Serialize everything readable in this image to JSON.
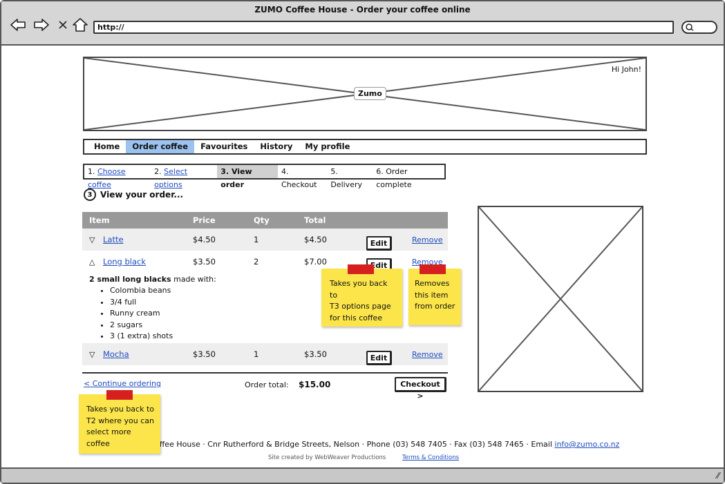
{
  "browser": {
    "title": "ZUMO Coffee House - Order your coffee online",
    "url": "http://"
  },
  "banner": {
    "logo": "Zumo",
    "greeting": "Hi John!"
  },
  "mainnav": [
    {
      "label": "Home",
      "active": false
    },
    {
      "label": "Order coffee",
      "active": true
    },
    {
      "label": "Favourites",
      "active": false
    },
    {
      "label": "History",
      "active": false
    },
    {
      "label": "My profile",
      "active": false
    }
  ],
  "steps": [
    {
      "num": "1.",
      "label": "Choose coffee"
    },
    {
      "num": "2.",
      "label": "Select options"
    },
    {
      "num": "3.",
      "label": "View order"
    },
    {
      "num": "4.",
      "label": "Checkout"
    },
    {
      "num": "5.",
      "label": "Delivery"
    },
    {
      "num": "6.",
      "label": "Order complete"
    }
  ],
  "heading": {
    "step_number": "3",
    "text": "View your order..."
  },
  "table": {
    "headers": {
      "item": "Item",
      "price": "Price",
      "qty": "Qty",
      "total": "Total"
    },
    "rows": [
      {
        "item": "Latte",
        "price": "$4.50",
        "qty": "1",
        "total": "$4.50",
        "edit": "Edit",
        "remove": "Remove"
      },
      {
        "item": "Long black",
        "price": "$3.50",
        "qty": "2",
        "total": "$7.00",
        "edit": "Edit",
        "remove": "Remove"
      },
      {
        "item": "Mocha",
        "price": "$3.50",
        "qty": "1",
        "total": "$3.50",
        "edit": "Edit",
        "remove": "Remove"
      }
    ],
    "details": {
      "bold": "2 small long blacks",
      "rest": " made with:",
      "options": [
        "Colombia beans",
        "3/4 full",
        "Runny cream",
        "2 sugars",
        "3 (1 extra) shots"
      ]
    }
  },
  "order_total": {
    "label": "Order total:",
    "value": "$15.00"
  },
  "continue_link": "< Continue ordering",
  "checkout_button": "Checkout >",
  "notes": {
    "edit_note": [
      "Takes you back to",
      "T3 options page",
      "for this coffee"
    ],
    "remove_note": [
      "Removes",
      "this item",
      "from order"
    ],
    "continue_note": [
      "Takes you back to",
      "T2 where you can",
      "select more coffee"
    ]
  },
  "footer": {
    "address": "offee House · Cnr Rutherford & Bridge Streets, Nelson · Phone (03) 548 7405 · Fax (03) 548 7465 · Email ",
    "email": "info@zumo.co.nz",
    "credit": "Site created by WebWeaver Productions",
    "terms": "Terms & Conditions"
  }
}
